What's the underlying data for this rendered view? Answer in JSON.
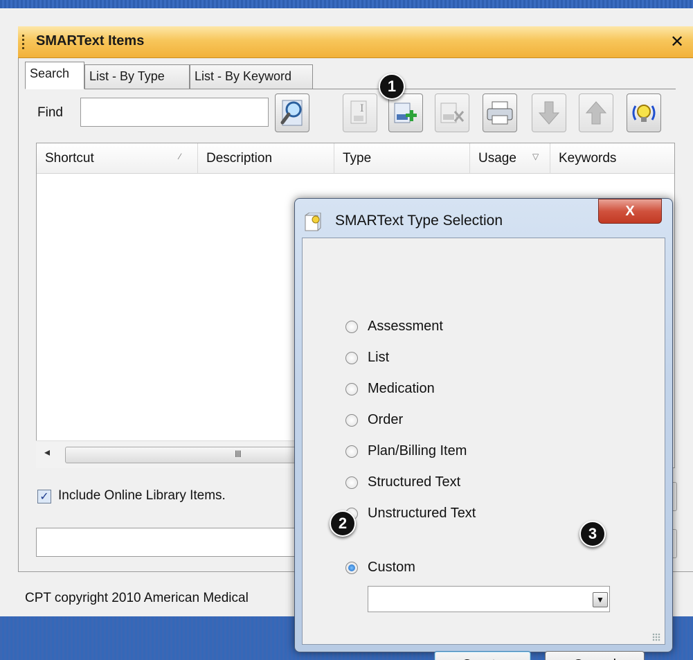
{
  "window": {
    "title": "SMARText Items",
    "close_glyph": "✕"
  },
  "tabs": [
    {
      "label": "Search",
      "active": true
    },
    {
      "label": "List - By Type",
      "active": false
    },
    {
      "label": "List - By Keyword",
      "active": false
    }
  ],
  "search": {
    "find_label": "Find",
    "find_value": ""
  },
  "toolbar": {
    "buttons": [
      {
        "icon": "edit-item-icon",
        "enabled": false
      },
      {
        "icon": "add-item-icon",
        "enabled": true
      },
      {
        "icon": "delete-item-icon",
        "enabled": false
      },
      {
        "icon": "print-icon",
        "enabled": true
      },
      {
        "icon": "move-down-icon",
        "enabled": false
      },
      {
        "icon": "move-up-icon",
        "enabled": false
      },
      {
        "icon": "lightbulb-icon",
        "enabled": true
      }
    ]
  },
  "grid": {
    "columns": [
      "Shortcut",
      "Description",
      "Type",
      "Usage",
      "Keywords"
    ],
    "rows": []
  },
  "options": {
    "include_online_label": "Include Online Library Items.",
    "include_online_checked": true
  },
  "footer": {
    "copyright": "CPT copyright 2010 American Medical"
  },
  "badges": {
    "one": "1",
    "two": "2",
    "three": "3"
  },
  "dialog": {
    "title": "SMARText Type Selection",
    "close_glyph": "X",
    "options": [
      {
        "label": "Assessment",
        "selected": false
      },
      {
        "label": "List",
        "selected": false
      },
      {
        "label": "Medication",
        "selected": false
      },
      {
        "label": "Order",
        "selected": false
      },
      {
        "label": "Plan/Billing Item",
        "selected": false
      },
      {
        "label": "Structured Text",
        "selected": false
      },
      {
        "label": "Unstructured Text",
        "selected": false
      }
    ],
    "custom_label": "Custom",
    "custom_selected": true,
    "custom_value": "",
    "create_label": "Create",
    "cancel_label": "Cancel"
  },
  "colors": {
    "title_bar": "#f7c65b",
    "desktop_blue": "#2b5aa8",
    "dialog_close": "#c23a24"
  }
}
